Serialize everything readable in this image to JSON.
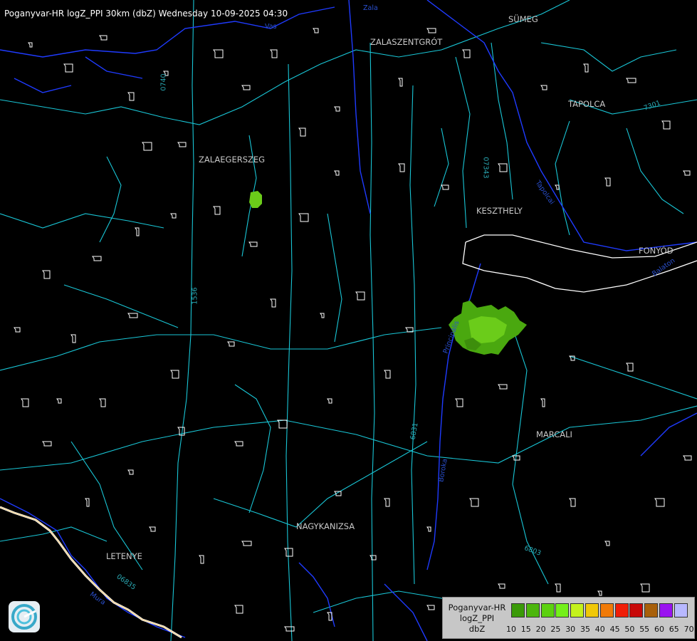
{
  "header": {
    "title": "Poganyvar-HR logZ_PPI 30km (dbZ) Wednesday 10-09-2025 04:30"
  },
  "cities": [
    "SÜMEG",
    "ZALASZENTGRÓT",
    "TAPOLCA",
    "ZALAEGERSZEG",
    "KESZTHELY",
    "FONYÓD",
    "MARCALI",
    "NAGYKANIZSA",
    "LETENYE"
  ],
  "road_labels": [
    "0740",
    "07343",
    "1536",
    "6831",
    "6803",
    "06835",
    "7301"
  ],
  "river_labels": [
    "Zala",
    "Vas",
    "Tapolcai",
    "Balaton",
    "Boroka",
    "Mura",
    "Principális"
  ],
  "legend": {
    "line1": "Poganyvar-HR",
    "line2": "logZ_PPI",
    "line3": "dbZ",
    "ticks": [
      "10",
      "15",
      "20",
      "25",
      "30",
      "35",
      "40",
      "45",
      "50",
      "55",
      "60",
      "65",
      "70"
    ],
    "colors": [
      "#3a9a08",
      "#4cb60c",
      "#5cd110",
      "#74f01a",
      "#c4f21c",
      "#f0c808",
      "#f07a08",
      "#f01e08",
      "#c80808",
      "#a8600a",
      "#9a12f0",
      "#b8b8ff"
    ]
  },
  "echo_colors": [
    "#4aa80f",
    "#6bcc1a",
    "#3d8e0c"
  ],
  "colors": {
    "road": "#19c6d6",
    "river": "#1f3bff",
    "border": "#f2d49a",
    "settlement": "#ffffff"
  },
  "icons": [
    "radar-logo-icon"
  ]
}
